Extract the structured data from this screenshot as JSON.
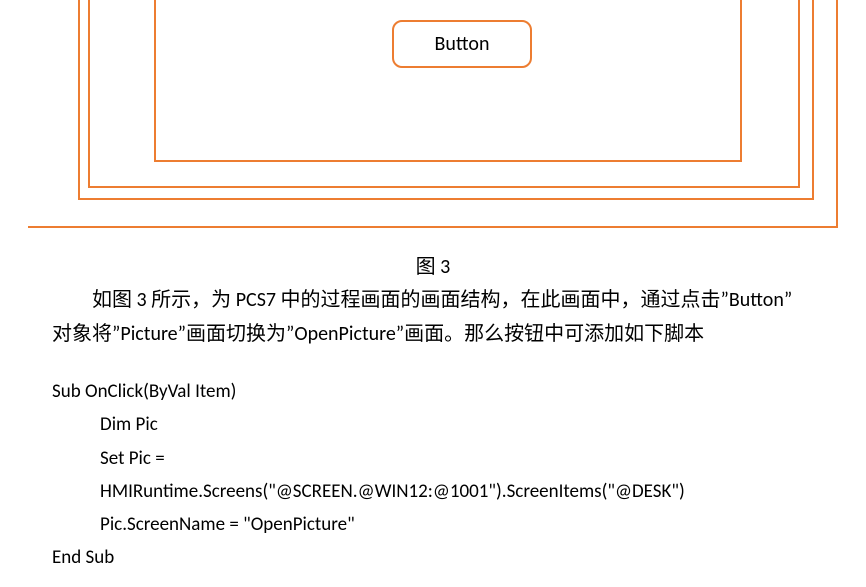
{
  "diagram": {
    "button_label": "Button"
  },
  "caption": "图 3",
  "paragraph": {
    "line1": "如图 3 所示，为 PCS7 中的过程画面的画面结构，在此画面中，通过点击”Button”",
    "line2": "对象将”Picture”画面切换为”OpenPicture”画面。那么按钮中可添加如下脚本"
  },
  "code": {
    "l1": "Sub OnClick(ByVal Item)",
    "l2": "Dim Pic",
    "l3": "Set Pic =",
    "l4": "HMIRuntime.Screens(\"@SCREEN.@WIN12:@1001\").ScreenItems(\"@DESK\")",
    "l5": "Pic.ScreenName = \"OpenPicture\"",
    "l6": "End Sub"
  }
}
